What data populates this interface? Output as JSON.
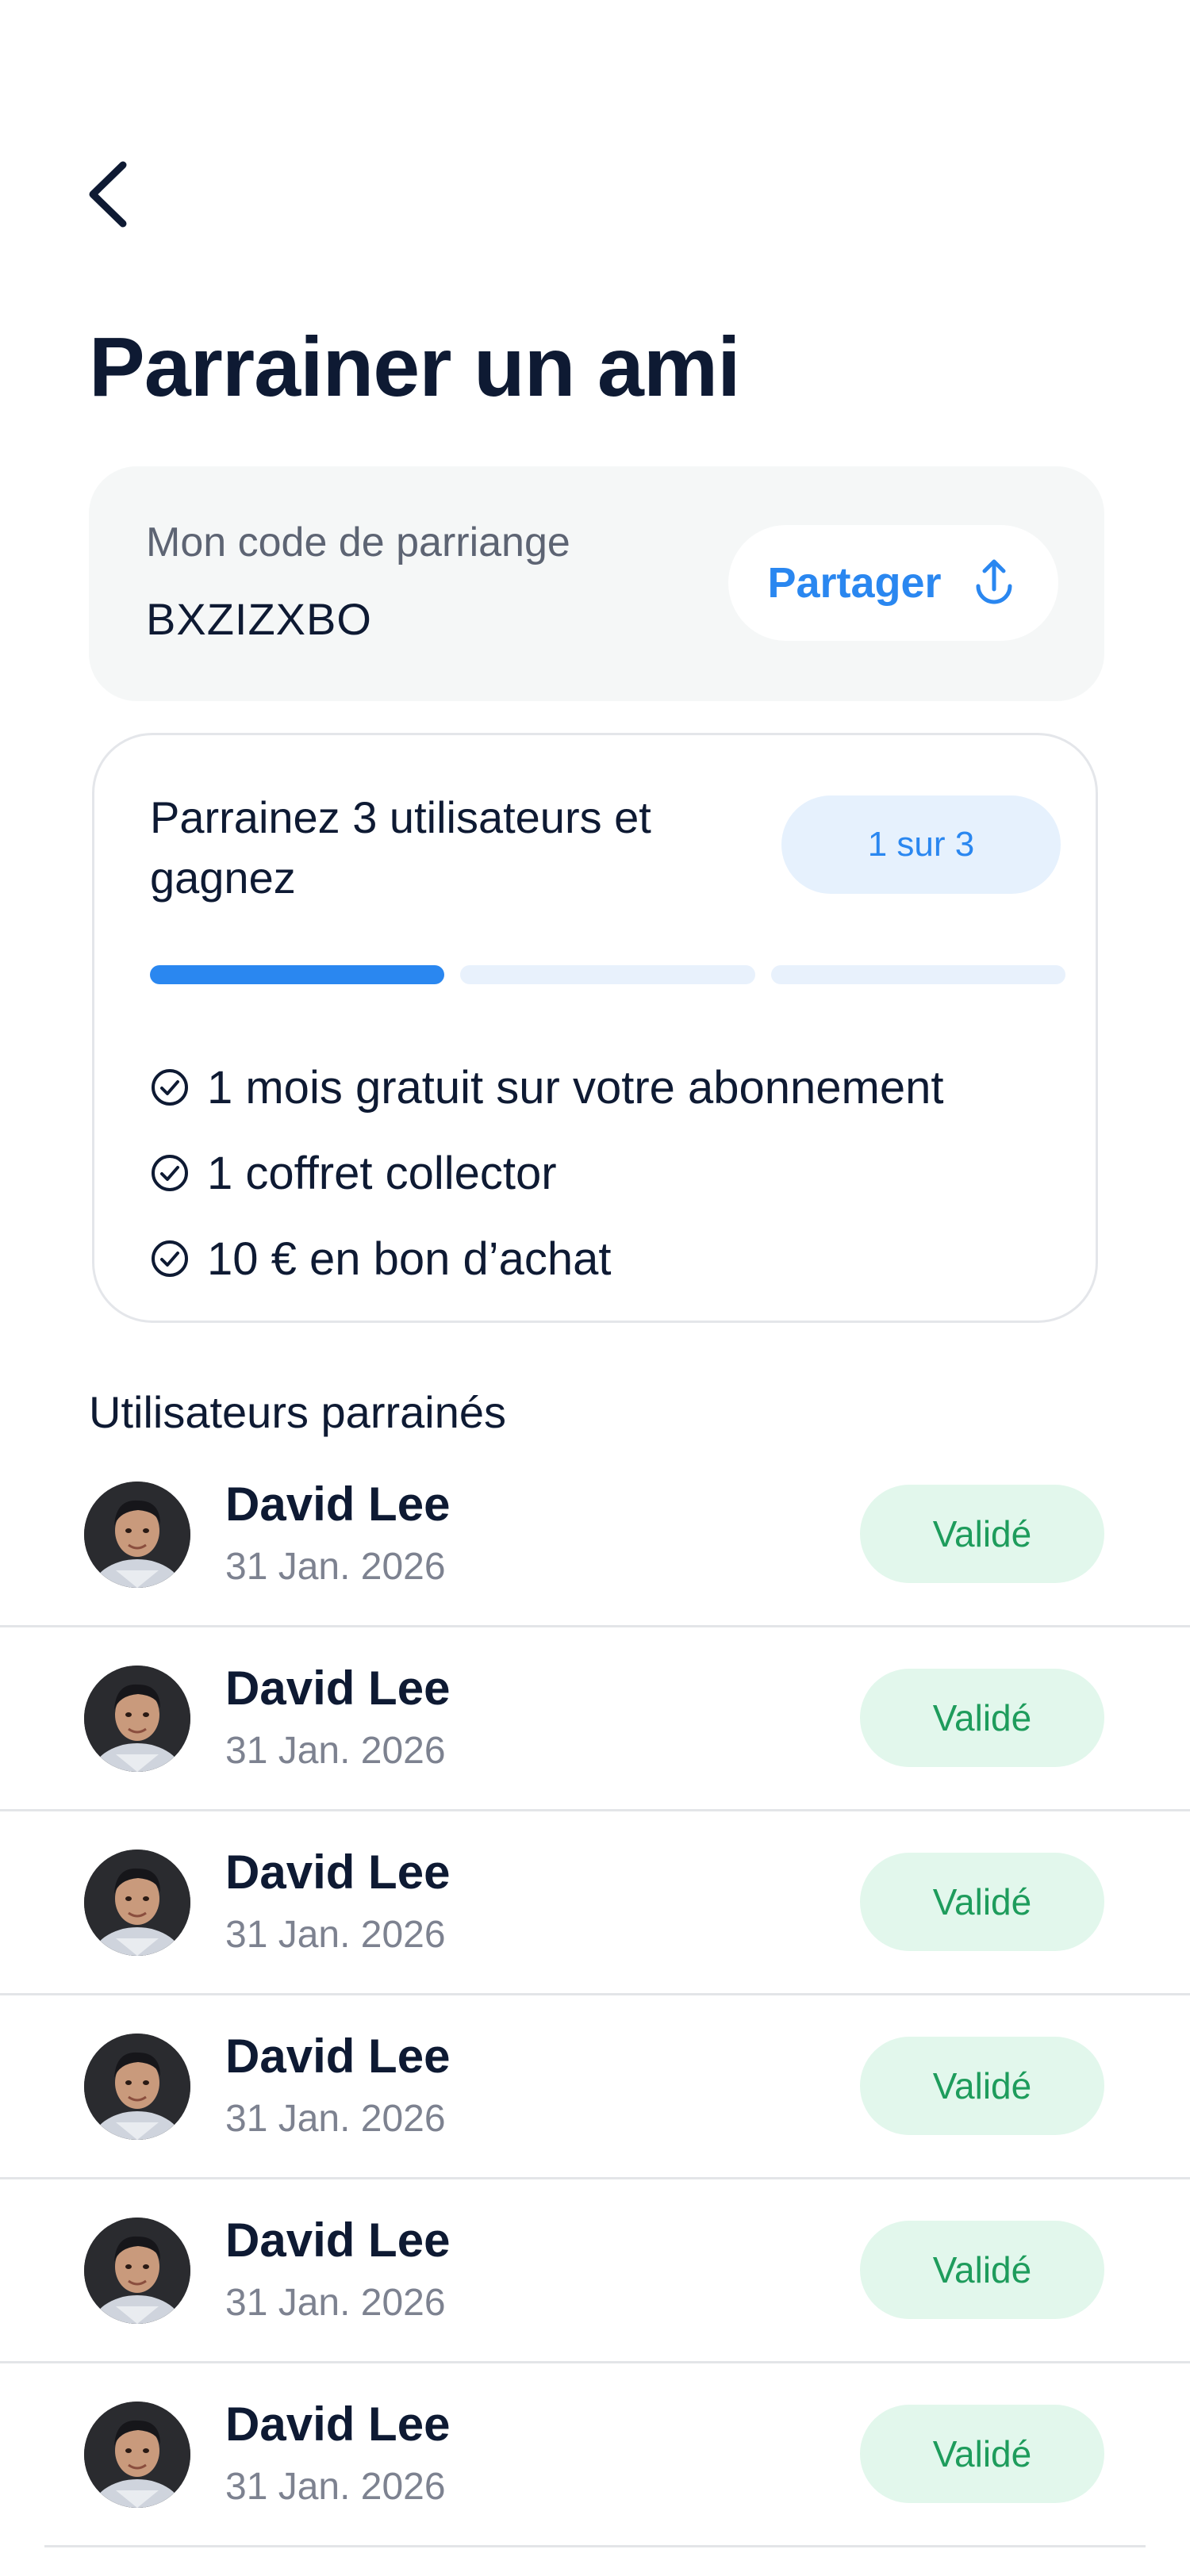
{
  "header": {
    "back_icon": "chevron-left-icon",
    "title": "Parrainer un ami"
  },
  "code_card": {
    "label": "Mon code de parriange",
    "code": "BXZIZXBO",
    "share_label": "Partager",
    "share_icon": "share-upload-icon"
  },
  "reward_card": {
    "title": "Parrainez 3 utilisateurs et gagnez",
    "progress_text": "1 sur 3",
    "progress": {
      "completed": 1,
      "total": 3
    },
    "benefits": [
      "1 mois gratuit sur votre abonnement",
      "1 coffret collector",
      "10 € en bon d’achat"
    ],
    "benefit_icon": "check-circle-icon"
  },
  "referrals": {
    "title": "Utilisateurs parrainés",
    "items": [
      {
        "name": "David Lee",
        "date": "31 Jan. 2026",
        "status": "Validé"
      },
      {
        "name": "David Lee",
        "date": "31 Jan. 2026",
        "status": "Validé"
      },
      {
        "name": "David Lee",
        "date": "31 Jan. 2026",
        "status": "Validé"
      },
      {
        "name": "David Lee",
        "date": "31 Jan. 2026",
        "status": "Validé"
      },
      {
        "name": "David Lee",
        "date": "31 Jan. 2026",
        "status": "Validé"
      },
      {
        "name": "David Lee",
        "date": "31 Jan. 2026",
        "status": "Validé"
      }
    ]
  },
  "colors": {
    "accent": "#2a87f0",
    "success": "#1e9c5c",
    "success_bg": "#e2f7ec",
    "text": "#0e1a33"
  }
}
